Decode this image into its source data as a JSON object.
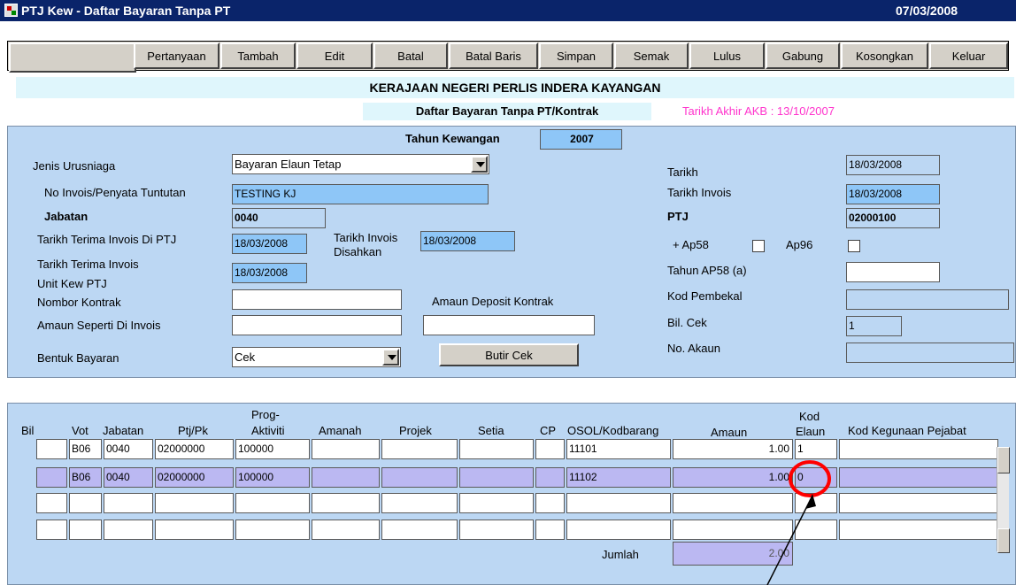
{
  "window": {
    "title": "PTJ Kew - Daftar Bayaran Tanpa PT",
    "date": "07/03/2008"
  },
  "toolbar": {
    "buttons": [
      "Pertanyaan",
      "Tambah",
      "Edit",
      "Batal",
      "Batal Baris",
      "Simpan",
      "Semak",
      "Lulus",
      "Gabung",
      "Kosongkan",
      "Keluar"
    ]
  },
  "header": {
    "org": "KERAJAAN NEGERI PERLIS INDERA KAYANGAN",
    "form_title": "Daftar Bayaran Tanpa PT/Kontrak",
    "akb": "Tarikh Akhir AKB : 13/10/2007"
  },
  "form": {
    "tahun_label": "Tahun Kewangan",
    "tahun_value": "2007",
    "jenis_label": "Jenis Urusniaga",
    "jenis_value": "Bayaran Elaun Tetap",
    "invois_label": "No Invois/Penyata Tuntutan",
    "invois_value": "TESTING KJ",
    "jabatan_label": "Jabatan",
    "jabatan_value": "0040",
    "ttip_label": "Tarikh Terima Invois Di PTJ",
    "ttip_value": "18/03/2008",
    "tid_label_1": "Tarikh Invois",
    "tid_label_2": "Disahkan",
    "tid_value": "18/03/2008",
    "ttiu_label_1": "Tarikh Terima Invois",
    "ttiu_label_2": "Unit Kew PTJ",
    "ttiu_value": "18/03/2008",
    "kontrak_label": "Nombor Kontrak",
    "kontrak_value": "",
    "deposit_label": "Amaun Deposit Kontrak",
    "deposit_value": "",
    "amaun_label": "Amaun Seperti Di Invois",
    "amaun_value": "",
    "bentuk_label": "Bentuk Bayaran",
    "bentuk_value": "Cek",
    "butir_button": "Butir Cek",
    "tarikh_label": "Tarikh",
    "tarikh_value": "18/03/2008",
    "tarikh_invois_label": "Tarikh Invois",
    "tarikh_invois_value": "18/03/2008",
    "ptj_label": "PTJ",
    "ptj_value": "02000100",
    "ap58_label": "+ Ap58",
    "ap96_label": "Ap96",
    "tahun_ap58_label": "Tahun AP58 (a)",
    "tahun_ap58_value": "",
    "pembekal_label": "Kod Pembekal",
    "pembekal_value": "",
    "bilcek_label": "Bil. Cek",
    "bilcek_value": "1",
    "akaun_label": "No. Akaun",
    "akaun_value": ""
  },
  "grid": {
    "headers": {
      "bil": "Bil",
      "vot": "Vot",
      "jabatan": "Jabatan",
      "ptj": "Ptj/Pk",
      "prog1": "Prog-",
      "prog2": "Aktiviti",
      "amanah": "Amanah",
      "projek": "Projek",
      "setia": "Setia",
      "cp": "CP",
      "osol": "OSOL/Kodbarang",
      "amaun": "Amaun",
      "kod1": "Kod",
      "kod2": "Elaun",
      "kegunaan": "Kod Kegunaan Pejabat"
    },
    "rows": [
      {
        "bil": "",
        "vot": "B06",
        "jabatan": "0040",
        "ptj": "02000000",
        "prog": "100000",
        "amanah": "",
        "projek": "",
        "setia": "",
        "cp": "",
        "osol": "11101",
        "amaun": "1.00",
        "kod": "1",
        "kegunaan": ""
      },
      {
        "bil": "",
        "vot": "B06",
        "jabatan": "0040",
        "ptj": "02000000",
        "prog": "100000",
        "amanah": "",
        "projek": "",
        "setia": "",
        "cp": "",
        "osol": "11102",
        "amaun": "1.00",
        "kod": "0",
        "kegunaan": ""
      },
      {
        "bil": "",
        "vot": "",
        "jabatan": "",
        "ptj": "",
        "prog": "",
        "amanah": "",
        "projek": "",
        "setia": "",
        "cp": "",
        "osol": "",
        "amaun": "",
        "kod": "",
        "kegunaan": ""
      },
      {
        "bil": "",
        "vot": "",
        "jabatan": "",
        "ptj": "",
        "prog": "",
        "amanah": "",
        "projek": "",
        "setia": "",
        "cp": "",
        "osol": "",
        "amaun": "",
        "kod": "",
        "kegunaan": ""
      }
    ],
    "jumlah_label": "Jumlah",
    "jumlah_value": "2.00"
  },
  "annotation": {
    "circle_color": "#ff0000"
  }
}
